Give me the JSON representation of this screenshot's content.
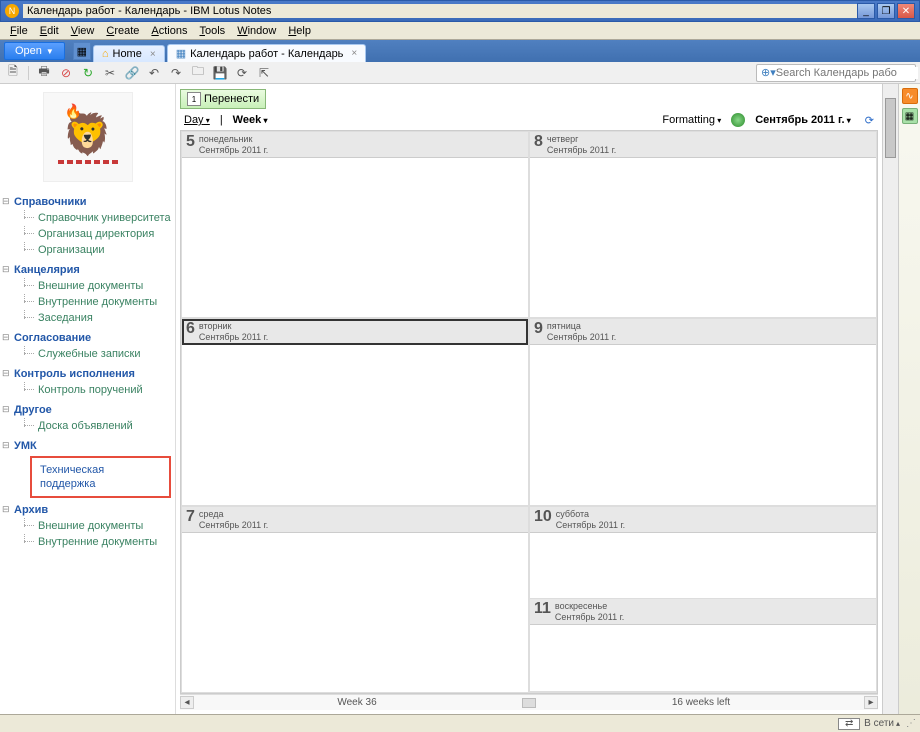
{
  "window": {
    "title": "Календарь работ - Календарь - IBM Lotus Notes"
  },
  "menu": {
    "file": "File",
    "edit": "Edit",
    "view": "View",
    "create": "Create",
    "actions": "Actions",
    "tools": "Tools",
    "window": "Window",
    "help": "Help"
  },
  "tabs": {
    "open": "Open",
    "home": "Home",
    "calendar": "Календарь работ - Календарь"
  },
  "search": {
    "placeholder": "Search Календарь рабо"
  },
  "sidebar": {
    "s1": {
      "title": "Справочники",
      "i1": "Справочник университета",
      "i2": "Организац директория",
      "i3": "Организации"
    },
    "s2": {
      "title": "Канцелярия",
      "i1": "Внешние документы",
      "i2": "Внутренние документы",
      "i3": "Заседания"
    },
    "s3": {
      "title": "Согласование",
      "i1": "Служебные записки"
    },
    "s4": {
      "title": "Контроль исполнения",
      "i1": "Контроль поручений"
    },
    "s5": {
      "title": "Другое",
      "i1": "Доска объявлений"
    },
    "s6": {
      "title": "УМК",
      "i1": "Техническая поддержка"
    },
    "s7": {
      "title": "Архив",
      "i1": "Внешние документы",
      "i2": "Внутренние документы"
    }
  },
  "calendar": {
    "move_btn": "Перенести",
    "view_day": "Day",
    "view_week": "Week",
    "formatting": "Formatting",
    "month_year": "Сентябрь 2011 г.",
    "month_sub": "Сентябрь 2011 г.",
    "d5": {
      "num": "5",
      "dow": "понедельник"
    },
    "d6": {
      "num": "6",
      "dow": "вторник"
    },
    "d7": {
      "num": "7",
      "dow": "среда"
    },
    "d8": {
      "num": "8",
      "dow": "четверг"
    },
    "d9": {
      "num": "9",
      "dow": "пятница"
    },
    "d10": {
      "num": "10",
      "dow": "суббота"
    },
    "d11": {
      "num": "11",
      "dow": "воскресенье"
    },
    "week_label": "Week 36",
    "weeks_left": "16 weeks left"
  },
  "status": {
    "network": "В сети"
  }
}
